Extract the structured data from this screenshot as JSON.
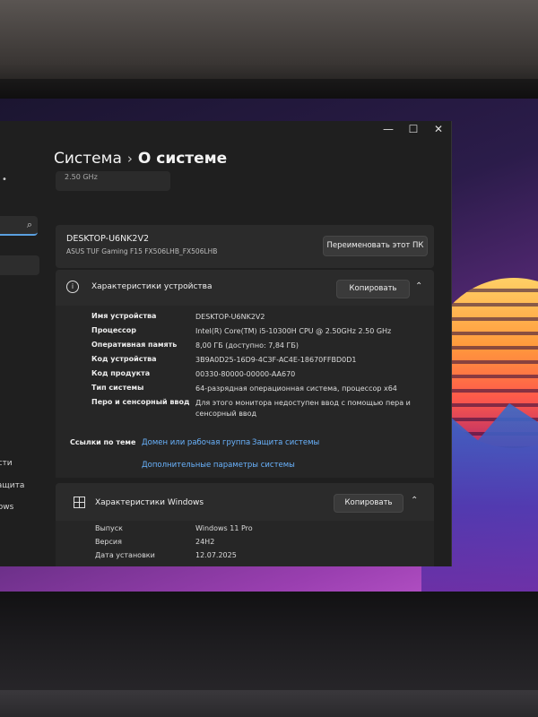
{
  "window": {
    "controls": {
      "minimize": "—",
      "maximize": "☐",
      "close": "✕"
    }
  },
  "breadcrumb": {
    "parent": "Система",
    "separator": "›",
    "current": "О системе"
  },
  "top_card_partial": "2.50 GHz",
  "sidebar": {
    "partial_items": [
      "ости",
      "защита",
      "dows"
    ]
  },
  "device": {
    "name": "DESKTOP-U6NK2V2",
    "model": "ASUS TUF Gaming F15 FX506LHB_FX506LHB",
    "rename_button": "Переименовать этот ПК"
  },
  "device_specs": {
    "title": "Характеристики устройства",
    "copy_button": "Копировать",
    "rows": [
      {
        "key": "Имя устройства",
        "value": "DESKTOP-U6NK2V2"
      },
      {
        "key": "Процессор",
        "value": "Intel(R) Core(TM) i5-10300H CPU @ 2.50GHz   2.50 GHz"
      },
      {
        "key": "Оперативная память",
        "value": "8,00 ГБ (доступно: 7,84 ГБ)"
      },
      {
        "key": "Код устройства",
        "value": "3B9A0D25-16D9-4C3F-AC4E-18670FFBD0D1"
      },
      {
        "key": "Код продукта",
        "value": "00330-80000-00000-AA670"
      },
      {
        "key": "Тип системы",
        "value": "64-разрядная операционная система, процессор x64"
      },
      {
        "key": "Перо и сенсорный ввод",
        "value": "Для этого монитора недоступен ввод с помощью пера и сенсорный ввод"
      }
    ]
  },
  "related_links": {
    "label": "Ссылки по теме",
    "links": [
      "Домен или рабочая группа",
      "Защита системы",
      "Дополнительные параметры системы"
    ]
  },
  "windows_specs": {
    "title": "Характеристики Windows",
    "copy_button": "Копировать",
    "rows": [
      {
        "key": "Выпуск",
        "value": "Windows 11 Pro"
      },
      {
        "key": "Версия",
        "value": "24H2"
      },
      {
        "key": "Дата установки",
        "value": "12.07.2025"
      }
    ]
  },
  "icons": {
    "search": "search-icon",
    "info": "info-icon",
    "windows": "windows-logo-icon",
    "chevron": "chevron-up-icon"
  }
}
